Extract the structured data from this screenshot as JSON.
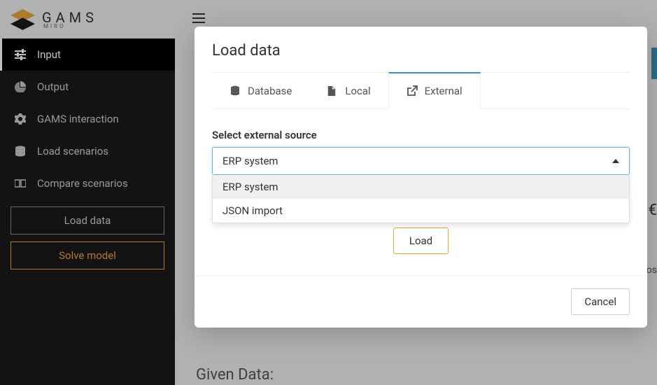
{
  "logo": {
    "text": "GAMS",
    "sub": "MIRO"
  },
  "sidebar": {
    "items": [
      {
        "label": "Input"
      },
      {
        "label": "Output"
      },
      {
        "label": "GAMS interaction"
      },
      {
        "label": "Load scenarios"
      },
      {
        "label": "Compare scenarios"
      }
    ],
    "load_btn": "Load data",
    "solve_btn": "Solve model"
  },
  "main": {
    "bottom_text": "Given Data:"
  },
  "modal": {
    "title": "Load data",
    "tabs": [
      {
        "label": "Database"
      },
      {
        "label": "Local"
      },
      {
        "label": "External"
      }
    ],
    "form_label": "Select external source",
    "selected": "ERP system",
    "options": [
      "ERP system",
      "JSON import"
    ],
    "load_btn": "Load",
    "cancel_btn": "Cancel"
  },
  "fragments": {
    "r2": "€",
    "r3": "os"
  }
}
